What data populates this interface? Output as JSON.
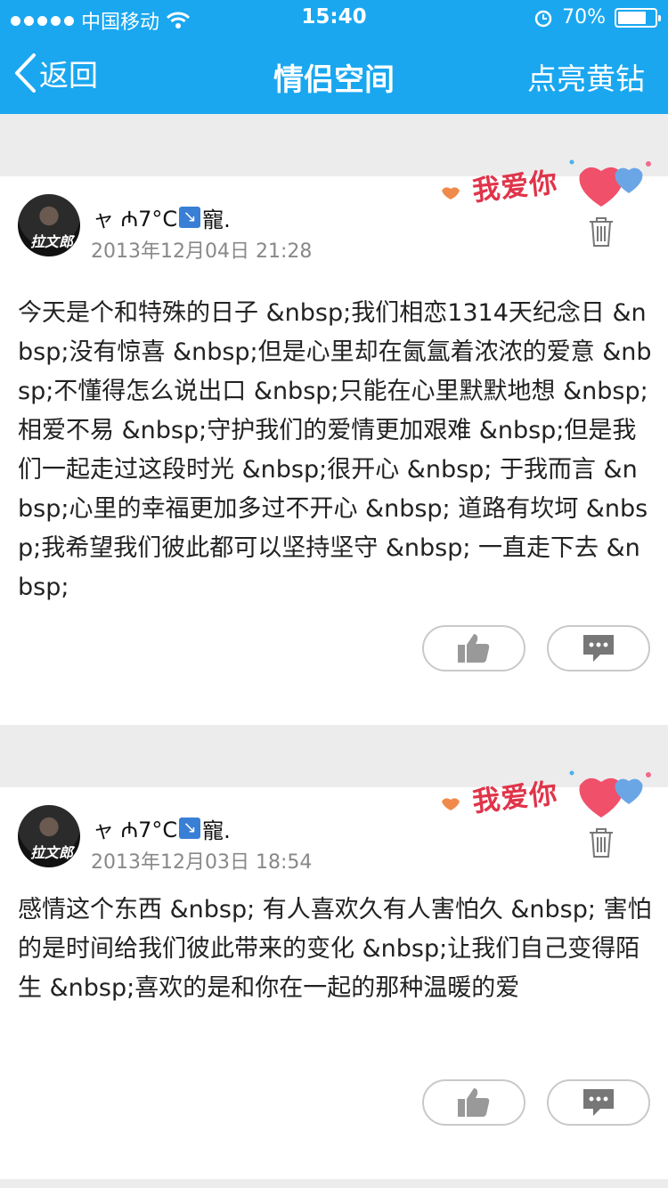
{
  "status_bar": {
    "carrier": "中国移动",
    "time": "15:40",
    "battery_percent": "70%",
    "battery_level": 0.7
  },
  "nav": {
    "back_label": "返回",
    "title": "情侣空间",
    "right_label": "点亮黄钻"
  },
  "posts": [
    {
      "username_prefix": "ャ ₼7°C",
      "username_suffix": "寵.",
      "badge_text": "我爱你",
      "date": "2013年12月04日 21:28",
      "body": "今天是个和特殊的日子 &nbsp;我们相恋1314天纪念日 &nbsp;没有惊喜 &nbsp;但是心里却在氤氲着浓浓的爱意 &nbsp;不懂得怎么说出口 &nbsp;只能在心里默默地想 &nbsp;相爱不易 &nbsp;守护我们的爱情更加艰难 &nbsp;但是我们一起走过这段时光 &nbsp;很开心 &nbsp; 于我而言 &nbsp;心里的幸福更加多过不开心 &nbsp; 道路有坎坷 &nbsp;我希望我们彼此都可以坚持坚守 &nbsp; 一直走下去 &nbsp;"
    },
    {
      "username_prefix": "ャ ₼7°C",
      "username_suffix": "寵.",
      "badge_text": "我爱你",
      "date": "2013年12月03日 18:54",
      "body": "感情这个东西 &nbsp; 有人喜欢久有人害怕久 &nbsp; 害怕的是时间给我们彼此带来的变化 &nbsp;让我们自己变得陌生 &nbsp;喜欢的是和你在一起的那种温暖的爱"
    }
  ],
  "colors": {
    "header_bg": "#1aa7f0",
    "badge_red": "#e0344a",
    "page_bg": "#ececec"
  },
  "icons": [
    "wifi-icon",
    "alarm-icon",
    "back-chevron-icon",
    "trash-icon",
    "thumbs-up-icon",
    "comment-icon",
    "heart-icon"
  ]
}
